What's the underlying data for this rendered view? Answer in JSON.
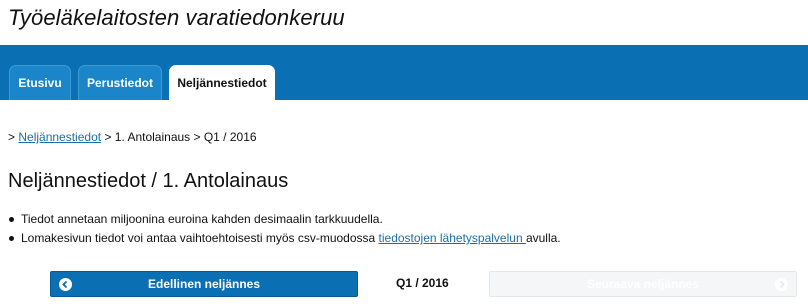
{
  "app": {
    "title": "Työeläkelaitosten varatiedonkeruu"
  },
  "tabs": [
    {
      "label": "Etusivu",
      "active": false
    },
    {
      "label": "Perustiedot",
      "active": false
    },
    {
      "label": "Neljännestiedot",
      "active": true
    }
  ],
  "breadcrumb": {
    "prefix": ">",
    "link": "Neljännestiedot",
    "rest": " > 1. Antolainaus > Q1 / 2016"
  },
  "page": {
    "title": "Neljännestiedot / 1. Antolainaus"
  },
  "info": {
    "line1": "Tiedot annetaan miljoonina euroina kahden desimaalin tarkkuudella.",
    "line2_before": "Lomakesivun tiedot voi antaa vaihtoehtoisesti myös csv-muodossa ",
    "line2_link": "tiedostojen lähetyspalvelun ",
    "line2_after": "avulla."
  },
  "pager": {
    "prev_label": "Edellinen neljännes",
    "current": "Q1 / 2016",
    "next_label": "Seuraava neljännes",
    "next_enabled": false
  },
  "colors": {
    "brand_blue": "#0a6fb3",
    "link": "#1b6fa8",
    "disabled_button": "#f4f6f8"
  }
}
